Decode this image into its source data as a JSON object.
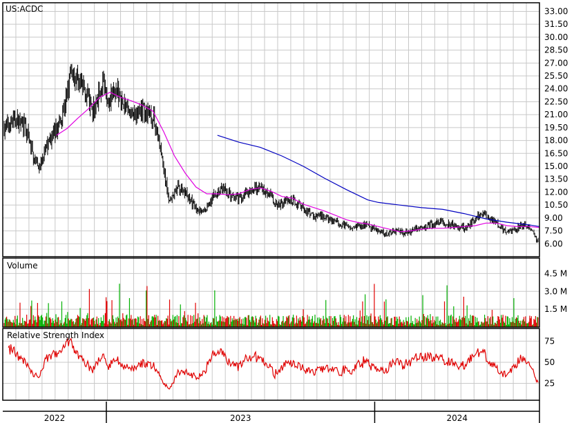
{
  "chart_data": {
    "type": "stock",
    "symbol": "US:ACDC",
    "price_panel": {
      "y_ticks": [
        6.0,
        7.5,
        9.0,
        10.5,
        12.0,
        13.5,
        15.0,
        16.5,
        18.0,
        19.5,
        21.0,
        22.5,
        24.0,
        25.5,
        27.0,
        28.5,
        30.0,
        31.5,
        33.0
      ],
      "ylim": [
        4.5,
        34.0
      ],
      "bar_color": "#000000",
      "ma_short_color": "#e000e0",
      "ma_long_color": "#0000c0",
      "ma_short": [
        [
          0.1,
          18.6
        ],
        [
          0.12,
          19.4
        ],
        [
          0.14,
          20.6
        ],
        [
          0.16,
          21.7
        ],
        [
          0.18,
          23.0
        ],
        [
          0.2,
          23.6
        ],
        [
          0.22,
          23.0
        ],
        [
          0.24,
          22.6
        ],
        [
          0.26,
          22.1
        ],
        [
          0.28,
          21.4
        ],
        [
          0.3,
          19.0
        ],
        [
          0.32,
          16.2
        ],
        [
          0.34,
          14.2
        ],
        [
          0.36,
          12.6
        ],
        [
          0.38,
          11.8
        ],
        [
          0.4,
          11.8
        ],
        [
          0.42,
          11.7
        ],
        [
          0.44,
          11.8
        ],
        [
          0.46,
          12.3
        ],
        [
          0.48,
          12.5
        ],
        [
          0.5,
          12.1
        ],
        [
          0.52,
          11.5
        ],
        [
          0.54,
          11.3
        ],
        [
          0.56,
          10.6
        ],
        [
          0.58,
          10.2
        ],
        [
          0.6,
          9.8
        ],
        [
          0.62,
          9.3
        ],
        [
          0.64,
          8.8
        ],
        [
          0.66,
          8.5
        ],
        [
          0.68,
          8.3
        ],
        [
          0.7,
          8.0
        ],
        [
          0.72,
          7.7
        ],
        [
          0.74,
          7.4
        ],
        [
          0.76,
          7.5
        ],
        [
          0.78,
          7.7
        ],
        [
          0.8,
          7.8
        ],
        [
          0.82,
          7.8
        ],
        [
          0.84,
          7.9
        ],
        [
          0.86,
          8.0
        ],
        [
          0.88,
          8.1
        ],
        [
          0.9,
          8.4
        ],
        [
          0.92,
          8.4
        ],
        [
          0.94,
          8.1
        ],
        [
          0.96,
          8.0
        ],
        [
          0.98,
          8.0
        ],
        [
          1.0,
          7.9
        ]
      ],
      "ma_long": [
        [
          0.4,
          18.6
        ],
        [
          0.44,
          17.8
        ],
        [
          0.48,
          17.2
        ],
        [
          0.52,
          16.2
        ],
        [
          0.56,
          15.0
        ],
        [
          0.6,
          13.6
        ],
        [
          0.64,
          12.3
        ],
        [
          0.68,
          11.1
        ],
        [
          0.7,
          10.8
        ],
        [
          0.74,
          10.5
        ],
        [
          0.78,
          10.2
        ],
        [
          0.82,
          10.0
        ],
        [
          0.86,
          9.5
        ],
        [
          0.9,
          8.9
        ],
        [
          0.94,
          8.5
        ],
        [
          0.98,
          8.2
        ],
        [
          1.0,
          8.0
        ]
      ]
    },
    "volume_panel": {
      "title": "Volume",
      "y_ticks": [
        "1.5 M",
        "3.0 M",
        "4.5 M"
      ],
      "y_tick_values": [
        1.5,
        3.0,
        4.5
      ],
      "ylim": [
        0,
        5.8
      ],
      "up_color": "#00b000",
      "down_color": "#e00000"
    },
    "rsi_panel": {
      "title": "Relative Strength Index",
      "y_ticks": [
        25,
        50,
        75
      ],
      "ylim": [
        5,
        90
      ],
      "line_color": "#e00000"
    },
    "x_axis": {
      "years": [
        "2022",
        "2023",
        "2024"
      ],
      "year_boundaries": [
        0.193,
        0.693
      ]
    }
  }
}
